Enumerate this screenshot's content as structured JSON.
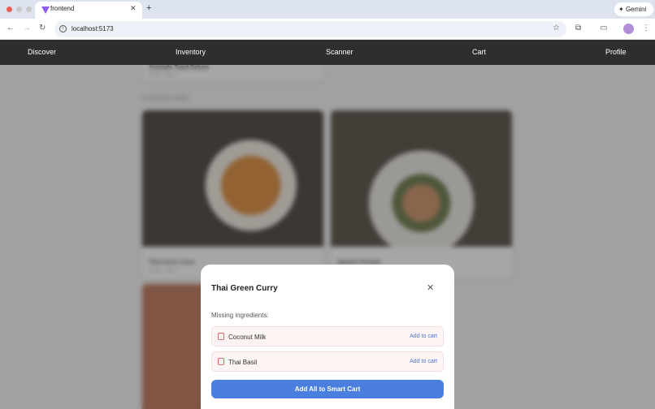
{
  "browser": {
    "tab_title": "frontend",
    "url": "localhost:5173",
    "gemini_label": "Gemini"
  },
  "app_nav": {
    "items": [
      {
        "label": "Discover"
      },
      {
        "label": "Inventory"
      },
      {
        "label": "Scanner"
      },
      {
        "label": "Cart"
      },
      {
        "label": "Profile"
      }
    ]
  },
  "background": {
    "top_card": {
      "title": "Avocado Toast Deluxe",
      "meta": "10 min · 1 item"
    },
    "section_title": "DISCOVER MORE",
    "cards": [
      {
        "title": "Thai Green Curry",
        "meta": "35 min · 1 item"
      },
      {
        "title": "Salmon Teriyaki",
        "meta": ""
      }
    ]
  },
  "modal": {
    "title": "Thai Green Curry",
    "missing_label": "Missing ingredients:",
    "ingredients": [
      {
        "name": "Coconut Milk",
        "action": "Add to cart"
      },
      {
        "name": "Thai Basil",
        "action": "Add to cart"
      }
    ],
    "add_all_label": "Add All to Smart Cart"
  },
  "colors": {
    "nav_bg": "#2e2e2e",
    "primary_button": "#4a7fe0",
    "link": "#4a72d8",
    "ingredient_icon": "#e06767"
  }
}
